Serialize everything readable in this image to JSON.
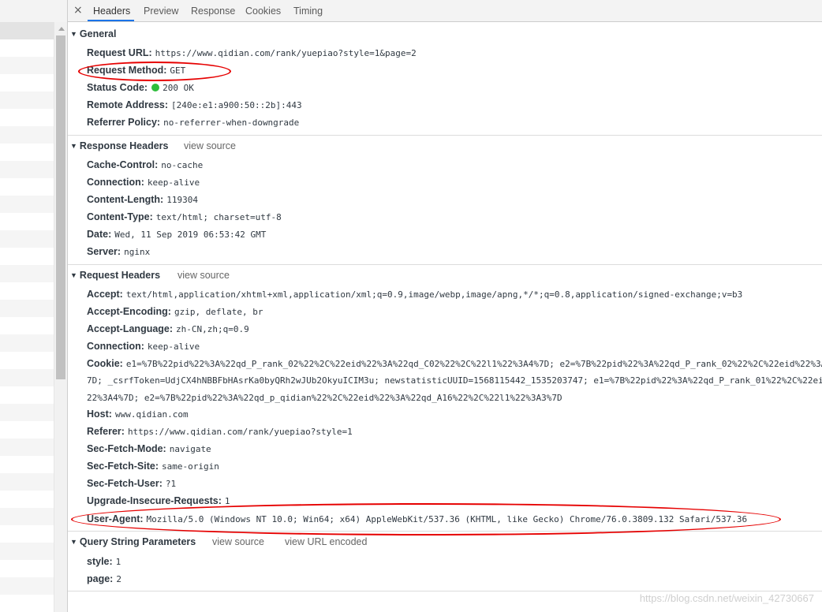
{
  "tabs": [
    {
      "label": "Headers",
      "active": true
    },
    {
      "label": "Preview",
      "active": false
    },
    {
      "label": "Response",
      "active": false
    },
    {
      "label": "Cookies",
      "active": false
    },
    {
      "label": "Timing",
      "active": false
    }
  ],
  "close_icon": "×",
  "triangle": "▼",
  "general": {
    "title": "General",
    "rows": [
      {
        "key": "Request URL:",
        "value": "https://www.qidian.com/rank/yuepiao?style=1&page=2"
      },
      {
        "key": "Request Method:",
        "value": "GET"
      },
      {
        "key": "Status Code:",
        "value": "200 OK",
        "status_color": "#2ebd3b"
      },
      {
        "key": "Remote Address:",
        "value": "[240e:e1:a900:50::2b]:443"
      },
      {
        "key": "Referrer Policy:",
        "value": "no-referrer-when-downgrade"
      }
    ]
  },
  "response_headers": {
    "title": "Response Headers",
    "view_source": "view source",
    "rows": [
      {
        "key": "Cache-Control:",
        "value": "no-cache"
      },
      {
        "key": "Connection:",
        "value": "keep-alive"
      },
      {
        "key": "Content-Length:",
        "value": "119304"
      },
      {
        "key": "Content-Type:",
        "value": "text/html; charset=utf-8"
      },
      {
        "key": "Date:",
        "value": "Wed, 11 Sep 2019 06:53:42 GMT"
      },
      {
        "key": "Server:",
        "value": "nginx"
      }
    ]
  },
  "request_headers": {
    "title": "Request Headers",
    "view_source": "view source",
    "accept": {
      "key": "Accept:",
      "value": "text/html,application/xhtml+xml,application/xml;q=0.9,image/webp,image/apng,*/*;q=0.8,application/signed-exchange;v=b3"
    },
    "accept_encoding": {
      "key": "Accept-Encoding:",
      "value": "gzip, deflate, br"
    },
    "accept_language": {
      "key": "Accept-Language:",
      "value": "zh-CN,zh;q=0.9"
    },
    "connection": {
      "key": "Connection:",
      "value": "keep-alive"
    },
    "cookie": {
      "key": "Cookie:",
      "line1": "e1=%7B%22pid%22%3A%22qd_P_rank_02%22%2C%22eid%22%3A%22qd_C02%22%2C%22l1%22%3A4%7D; e2=%7B%22pid%22%3A%22qd_P_rank_02%22%2C%22eid%22%3A",
      "line2": "7D; _csrfToken=UdjCX4hNBBFbHAsrKa0byQRh2wJUb2OkyuICIM3u; newstatisticUUID=1568115442_1535203747; e1=%7B%22pid%22%3A%22qd_P_rank_01%22%2C%22eid",
      "line3": "22%3A4%7D; e2=%7B%22pid%22%3A%22qd_p_qidian%22%2C%22eid%22%3A%22qd_A16%22%2C%22l1%22%3A3%7D"
    },
    "host": {
      "key": "Host:",
      "value": "www.qidian.com"
    },
    "referer": {
      "key": "Referer:",
      "value": "https://www.qidian.com/rank/yuepiao?style=1"
    },
    "sec_fetch_mode": {
      "key": "Sec-Fetch-Mode:",
      "value": "navigate"
    },
    "sec_fetch_site": {
      "key": "Sec-Fetch-Site:",
      "value": "same-origin"
    },
    "sec_fetch_user": {
      "key": "Sec-Fetch-User:",
      "value": "?1"
    },
    "upgrade_insecure": {
      "key": "Upgrade-Insecure-Requests:",
      "value": "1"
    },
    "user_agent": {
      "key": "User-Agent:",
      "value": "Mozilla/5.0 (Windows NT 10.0; Win64; x64) AppleWebKit/537.36 (KHTML, like Gecko) Chrome/76.0.3809.132 Safari/537.36"
    }
  },
  "query_string": {
    "title": "Query String Parameters",
    "view_source": "view source",
    "view_url_encoded": "view URL encoded",
    "rows": [
      {
        "key": "style:",
        "value": "1"
      },
      {
        "key": "page:",
        "value": "2"
      }
    ]
  },
  "watermark": "https://blog.csdn.net/weixin_42730667",
  "annotation_color": "#e60000"
}
